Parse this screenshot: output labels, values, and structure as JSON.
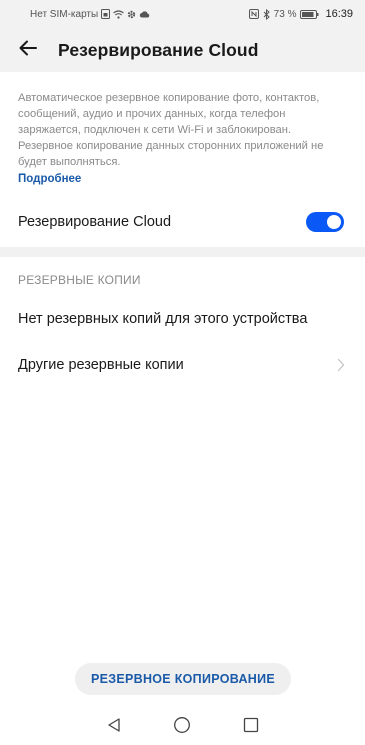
{
  "status_bar": {
    "carrier": "Нет SIM-карты",
    "battery_percent": "73 %",
    "time": "16:39",
    "icons": [
      "sim-card-icon",
      "wifi-icon",
      "settings-icon",
      "cloud-icon",
      "nfc-icon",
      "bluetooth-icon",
      "battery-icon"
    ]
  },
  "header": {
    "title": "Резервирование Cloud"
  },
  "description": {
    "text": "Автоматическое резервное копирование фото, контактов, сообщений, аудио и прочих данных, когда телефон заряжается, подключен к сети Wi-Fi и заблокирован. Резервное копирование данных сторонних приложений не будет выполняться.",
    "more_link": "Подробнее"
  },
  "cloud_backup_toggle": {
    "label": "Резервирование Cloud",
    "enabled": true
  },
  "backups_section": {
    "header": "РЕЗЕРВНЫЕ КОПИИ",
    "no_backups_text": "Нет резервных копий для этого устройства",
    "other_backups_label": "Другие резервные копии"
  },
  "actions": {
    "backup_button": "РЕЗЕРВНОЕ КОПИРОВАНИЕ"
  },
  "colors": {
    "accent": "#0a59f7",
    "link": "#1a5aa8",
    "header_bg": "#f2f2f2"
  }
}
